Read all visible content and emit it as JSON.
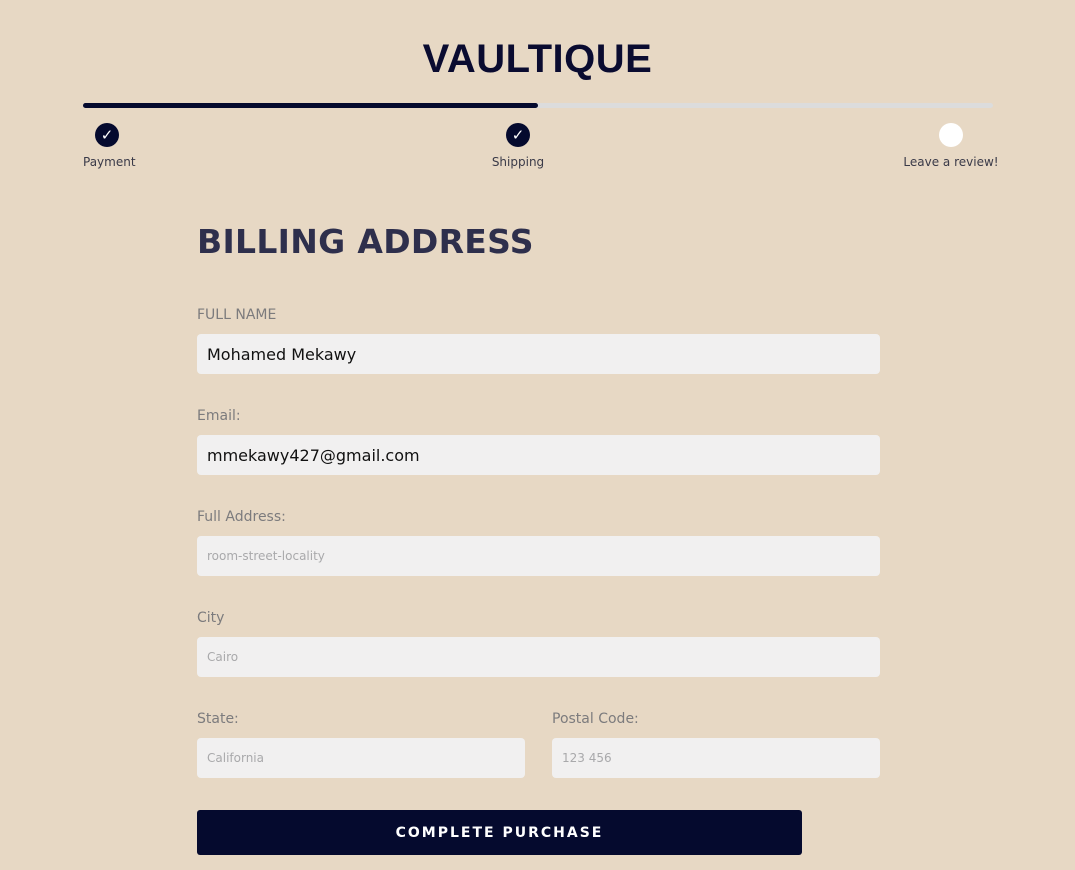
{
  "brand": "VAULTIQUE",
  "progress": {
    "fraction": 0.5
  },
  "steps": [
    {
      "label": "Payment",
      "status": "done",
      "icon": "check-icon"
    },
    {
      "label": "Shipping",
      "status": "done",
      "icon": "check-icon"
    },
    {
      "label": "Leave a review!",
      "status": "todo",
      "icon": ""
    }
  ],
  "check_glyph": "✓",
  "form": {
    "heading": "BILLING ADDRESS",
    "full_name": {
      "label": "FULL NAME",
      "value": "Mohamed Mekawy"
    },
    "email": {
      "label": "Email:",
      "value": "mmekawy427@gmail.com"
    },
    "address": {
      "label": "Full Address:",
      "placeholder": "room-street-locality"
    },
    "city": {
      "label": "City",
      "placeholder": "Cairo"
    },
    "state": {
      "label": "State:",
      "placeholder": "California"
    },
    "postal": {
      "label": "Postal Code:",
      "placeholder": "123 456"
    },
    "submit_label": "COMPLETE PURCHASE"
  },
  "colors": {
    "background": "#e7d8c4",
    "accent": "#050a2e",
    "track": "#dcdcdc",
    "field": "#f1f0f0"
  }
}
